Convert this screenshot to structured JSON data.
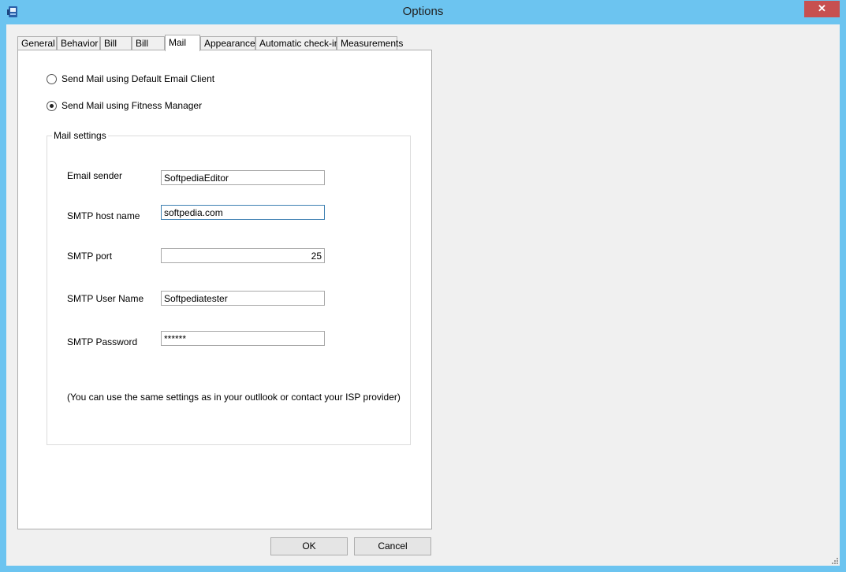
{
  "window": {
    "title": "Options",
    "close_glyph": "✕"
  },
  "tabs": [
    {
      "label": "General",
      "active": false
    },
    {
      "label": "Behavior",
      "active": false
    },
    {
      "label": "Bill",
      "active": false
    },
    {
      "label": "Bill",
      "active": false
    },
    {
      "label": "Mail",
      "active": true
    },
    {
      "label": "Appearance",
      "active": false
    },
    {
      "label": "Automatic check-in",
      "active": false
    },
    {
      "label": "Measurements",
      "active": false
    }
  ],
  "mail": {
    "option_default_client": "Send Mail using Default Email Client",
    "option_fitness_manager": "Send Mail using Fitness Manager",
    "selected_option": "fitness_manager",
    "group_title": "Mail settings",
    "fields": {
      "email_sender": {
        "label": "Email sender",
        "value": "SoftpediaEditor"
      },
      "smtp_host": {
        "label": "SMTP host name",
        "value": "softpedia.com"
      },
      "smtp_port": {
        "label": "SMTP port",
        "value": "25"
      },
      "smtp_user": {
        "label": "SMTP User Name",
        "value": "Softpediatester"
      },
      "smtp_password": {
        "label": "SMTP Password",
        "value": "******"
      }
    },
    "note": "(You can use the same settings as in your outllook or contact your ISP provider)"
  },
  "buttons": {
    "ok": "OK",
    "cancel": "Cancel"
  },
  "colors": {
    "titlebar": "#6cc4f0",
    "close": "#c75050",
    "dialog_bg": "#f0f0f0"
  }
}
